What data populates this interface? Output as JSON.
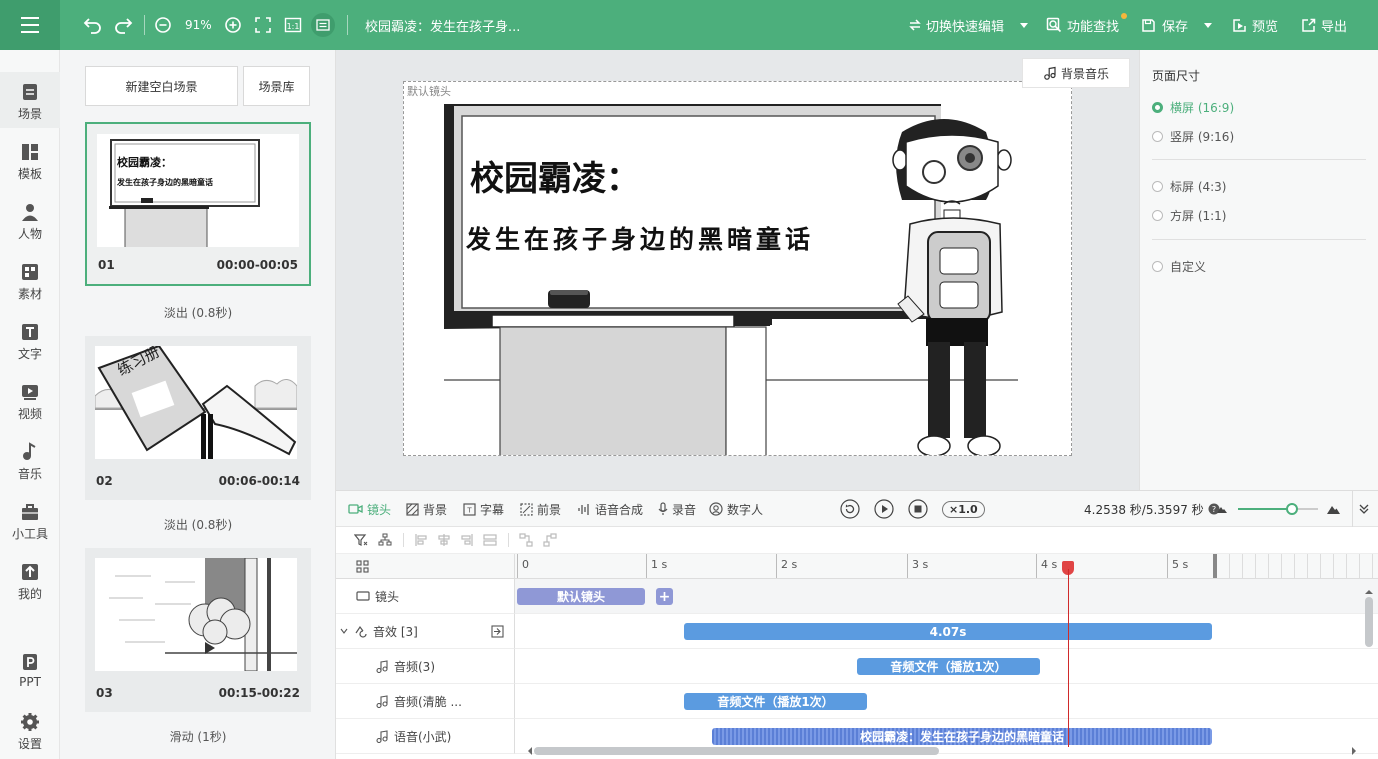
{
  "topbar": {
    "zoom": "91%",
    "doc_title": "校园霸凌：发生在孩子身...",
    "switch_edit": "切换快速编辑",
    "feature_search": "功能查找",
    "save": "保存",
    "preview": "预览",
    "export": "导出"
  },
  "nav": {
    "items": [
      "场景",
      "模板",
      "人物",
      "素材",
      "文字",
      "视频",
      "音乐",
      "小工具",
      "我的",
      "PPT",
      "设置"
    ]
  },
  "scenes": {
    "new_blank": "新建空白场景",
    "library": "场景库",
    "list": [
      {
        "num": "01",
        "time": "00:00-00:05",
        "transition": "淡出 (0.8秒)"
      },
      {
        "num": "02",
        "time": "00:06-00:14",
        "transition": "淡出 (0.8秒)"
      },
      {
        "num": "03",
        "time": "00:15-00:22",
        "transition": "滑动 (1秒)"
      }
    ]
  },
  "stage": {
    "camera_label": "默认镜头",
    "bg_music": "背景音乐",
    "title_line1": "校园霸凌：",
    "title_line2": "发生在孩子身边的黑暗童话",
    "thumb1_line1": "校园霸凌：",
    "thumb1_line2": "发生在孩子身边的黑暗童话",
    "thumb2_text": "练习册"
  },
  "page_size": {
    "title": "页面尺寸",
    "options": [
      "横屏 (16:9)",
      "竖屏 (9:16)",
      "标屏 (4:3)",
      "方屏 (1:1)",
      "自定义"
    ],
    "selected": "横屏 (16:9)"
  },
  "timeline": {
    "tabs": [
      "镜头",
      "背景",
      "字幕",
      "前景",
      "语音合成",
      "录音",
      "数字人"
    ],
    "active_tab": "镜头",
    "speed": "×1.0",
    "time_readout": "4.2538 秒/5.3597 秒",
    "ruler": [
      "0",
      "1 s",
      "2 s",
      "3 s",
      "4 s",
      "5 s"
    ],
    "tracks": [
      {
        "label": "镜头",
        "clips": [
          "默认镜头"
        ],
        "add": "+"
      },
      {
        "label": "音效 [3]",
        "clips": [
          "4.07s"
        ]
      },
      {
        "label": "音频(3)",
        "clips": [
          "音频文件（播放1次）"
        ]
      },
      {
        "label": "音频(清脆 ...",
        "clips": [
          "音频文件（播放1次）"
        ]
      },
      {
        "label": "语音(小武)",
        "clips": [
          "校园霸凌：发生在孩子身边的黑暗童话"
        ]
      }
    ]
  },
  "colors": {
    "accent": "#4caf7c",
    "clip_blue": "#5b9be0",
    "camera_clip": "#8f98d6",
    "playhead": "#d02a2a"
  }
}
